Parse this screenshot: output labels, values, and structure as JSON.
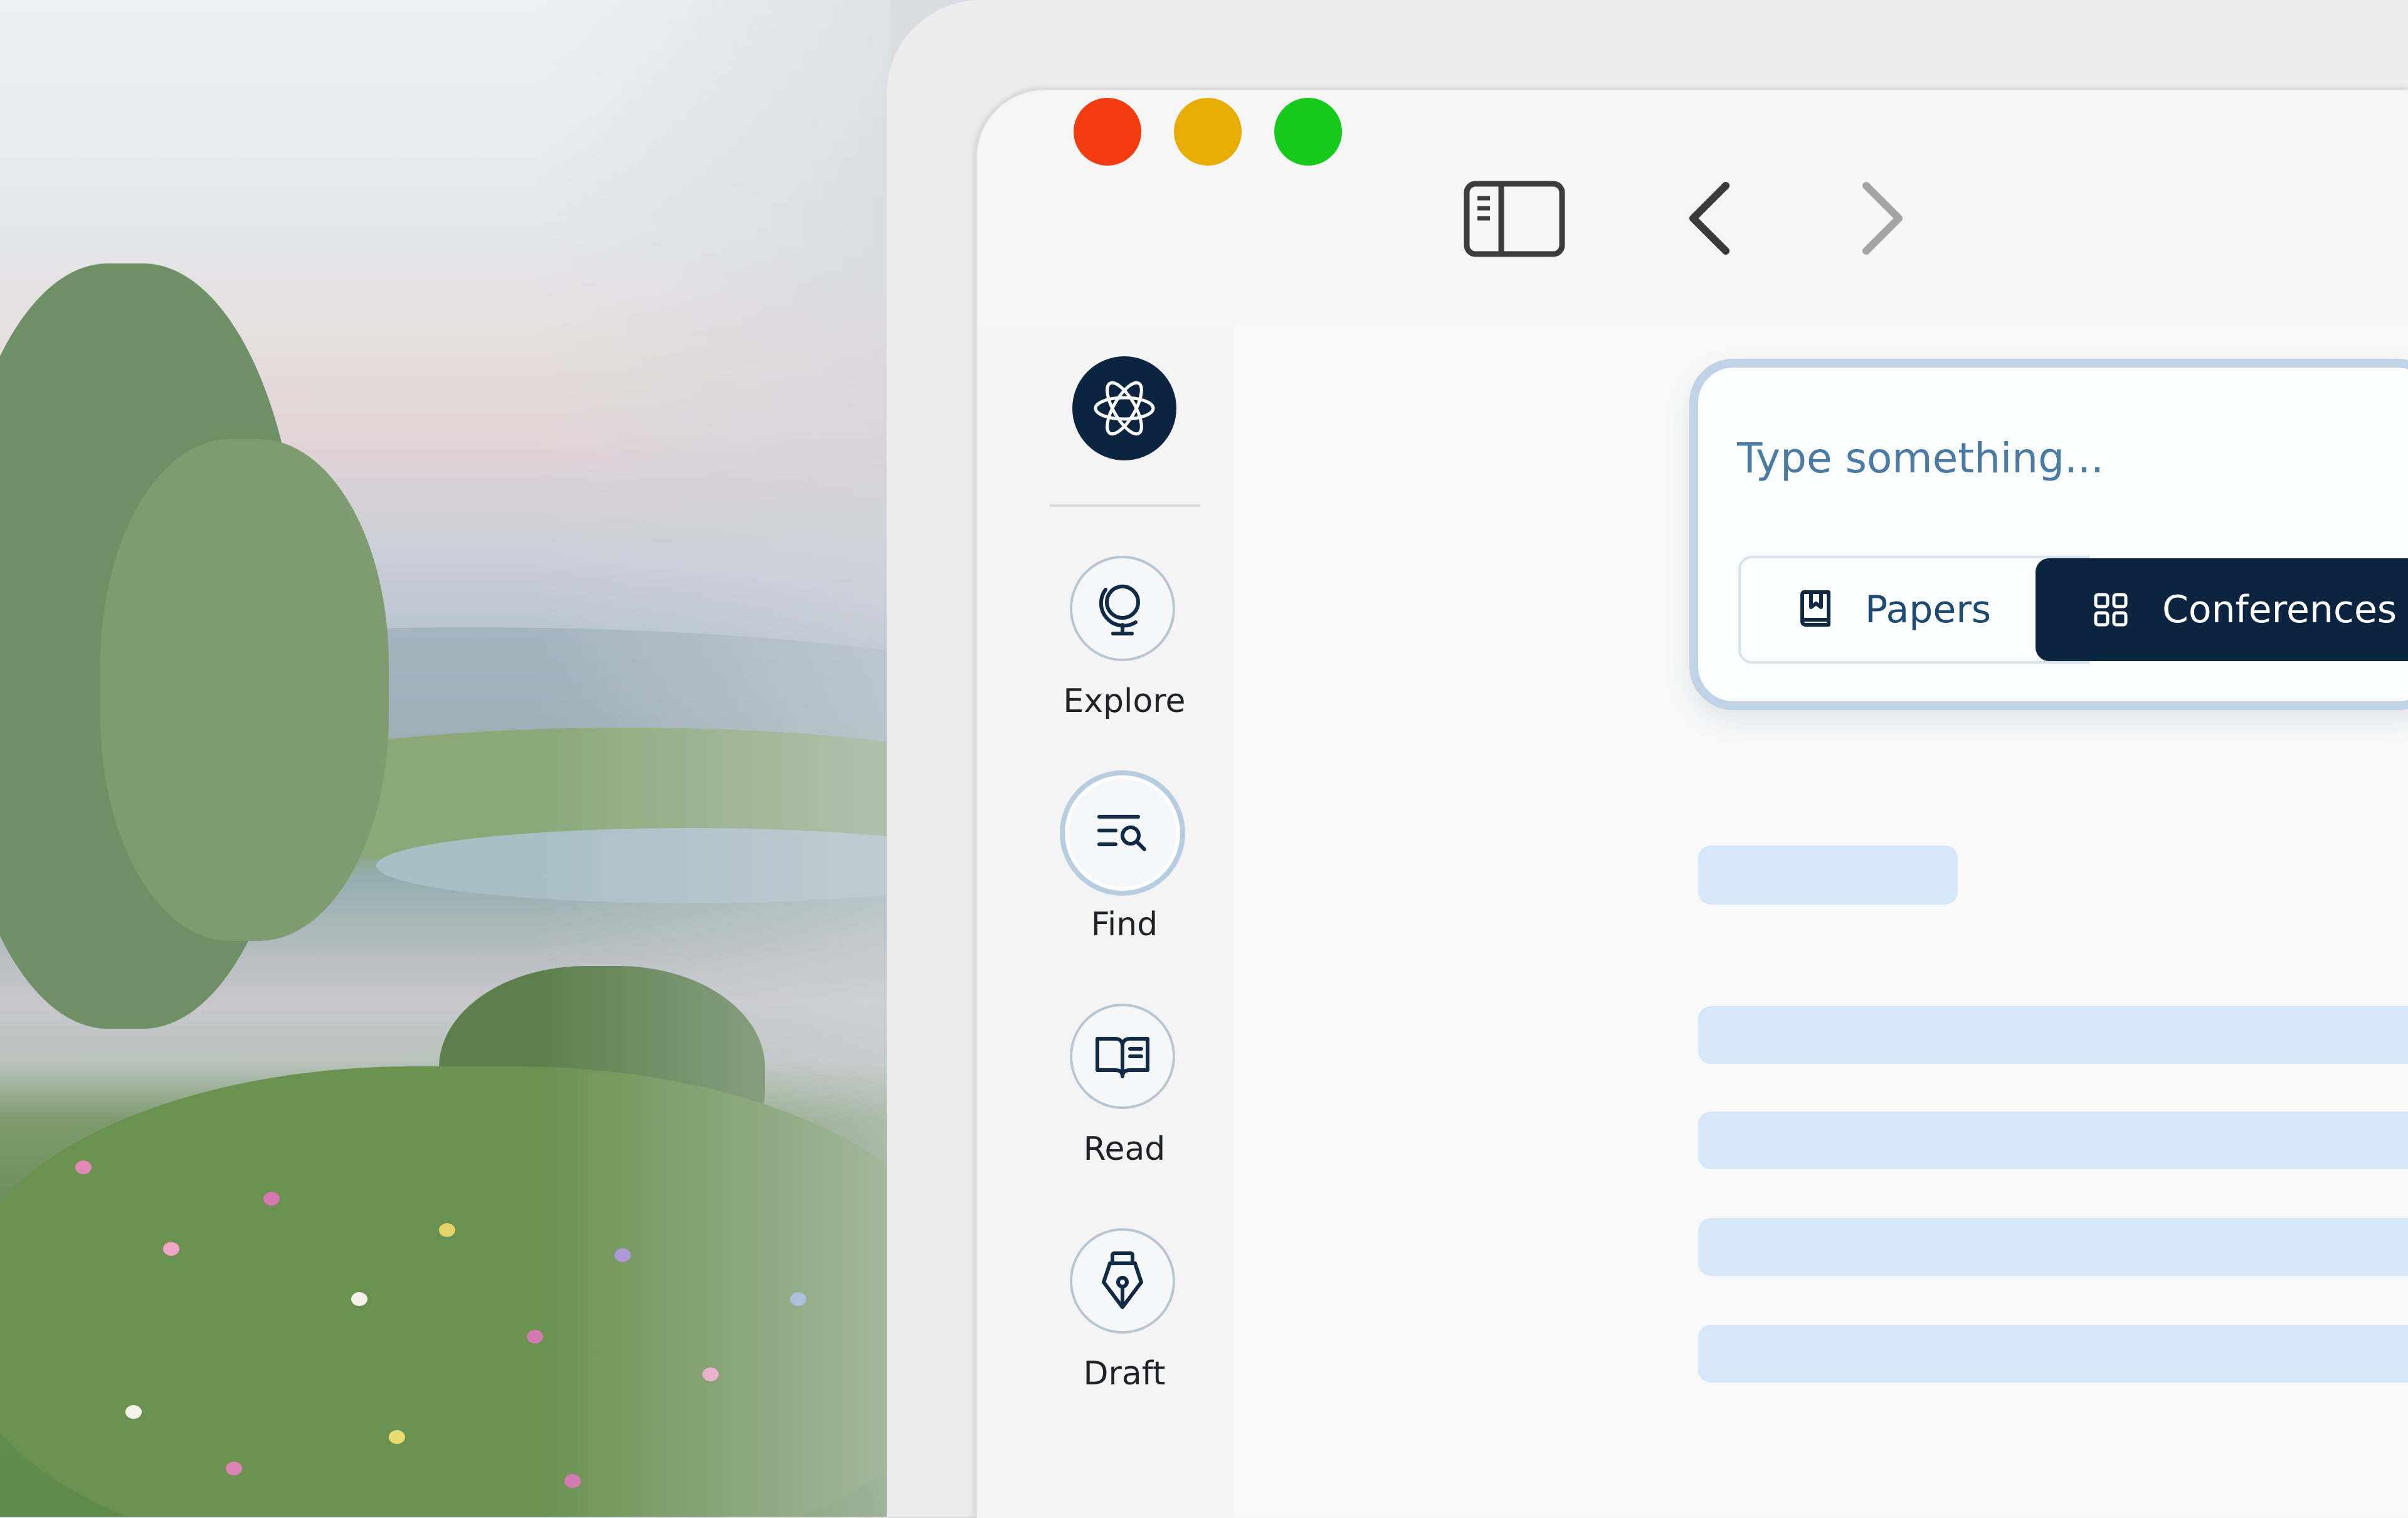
{
  "window": {
    "controls": [
      {
        "name": "close",
        "color": "#f53b11"
      },
      {
        "name": "minimize",
        "color": "#e8ad04"
      },
      {
        "name": "zoom",
        "color": "#16c91a"
      }
    ],
    "toolbar_icons": [
      "sidebar-toggle-icon",
      "chevron-left-icon",
      "chevron-right-icon"
    ]
  },
  "sidebar": {
    "logo_icon": "atom-icon",
    "items": [
      {
        "label": "Explore",
        "icon": "globe-icon",
        "active": false
      },
      {
        "label": "Find",
        "icon": "search-list-icon",
        "active": true
      },
      {
        "label": "Read",
        "icon": "open-book-icon",
        "active": false
      },
      {
        "label": "Draft",
        "icon": "fountain-pen-icon",
        "active": false
      }
    ]
  },
  "search": {
    "placeholder": "Type something...",
    "value": "",
    "filters": [
      {
        "label": "Papers",
        "icon": "bookmark-book-icon",
        "selected": false
      },
      {
        "label": "Conferences",
        "icon": "grid-icon",
        "selected": true
      }
    ]
  },
  "colors": {
    "accent": "#0c2440",
    "placeholder_text": "#4b7aa3",
    "skeleton": "#d6e7f9",
    "card_border": "#c0d3e6"
  }
}
